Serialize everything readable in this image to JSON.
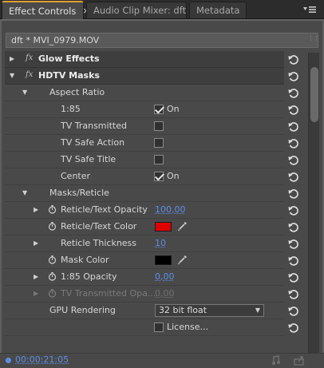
{
  "tabs": [
    {
      "label": "Effect Controls",
      "active": true,
      "close": "×"
    },
    {
      "label": "Audio Clip Mixer: dft",
      "active": false
    },
    {
      "label": "Metadata",
      "active": false
    }
  ],
  "panel_menu_icon": "panel-menu-icon",
  "clip_header": "dft * MVI_0979.MOV",
  "fx_symbol": "fx",
  "rows": {
    "glow_effects": "Glow Effects",
    "hdtv_masks": "HDTV Masks",
    "aspect_ratio": "Aspect Ratio",
    "r185": {
      "label": "1:85",
      "state": "On",
      "checked": true
    },
    "tv_transmitted": {
      "label": "TV Transmitted",
      "checked": false
    },
    "tv_safe_action": {
      "label": "TV Safe Action",
      "checked": false
    },
    "tv_safe_title": {
      "label": "TV Safe Title",
      "checked": false
    },
    "center": {
      "label": "Center",
      "state": "On",
      "checked": true
    },
    "masks_reticle": "Masks/Reticle",
    "reticle_text_opacity": {
      "label": "Reticle/Text Opacity",
      "value": "100,00"
    },
    "reticle_text_color": {
      "label": "Reticle/Text Color",
      "color": "#e00000"
    },
    "reticle_thickness": {
      "label": "Reticle Thickness",
      "value": "10"
    },
    "mask_color": {
      "label": "Mask Color",
      "color": "#000000"
    },
    "opacity_185": {
      "label": "1:85 Opacity",
      "value": "0,00"
    },
    "tv_transmitted_opacity": {
      "label": "TV Transmitted Opa...",
      "value": "0,00"
    },
    "gpu_rendering": {
      "label": "GPU Rendering",
      "value": "32 bit float"
    },
    "license": {
      "label": "License..."
    }
  },
  "timecode": "00:00:21:05",
  "colors": {
    "accent_tab": "#e1a034",
    "value_blue": "#5d8ee6",
    "panel_bg": "#494949"
  }
}
